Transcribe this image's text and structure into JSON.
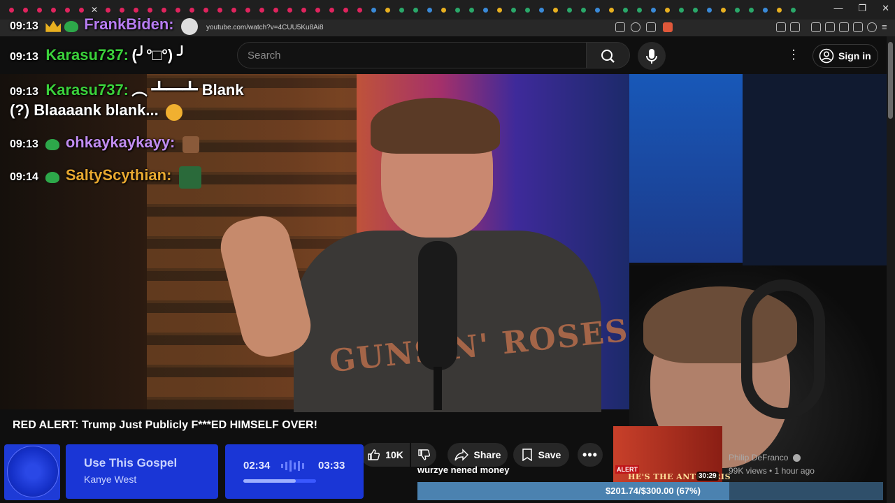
{
  "browser": {
    "url": "youtube.com/watch?v=4CUU5Ku8Ai8"
  },
  "header": {
    "search_placeholder": "Search",
    "sign_in_label": "Sign in"
  },
  "chat": [
    {
      "time": "09:13",
      "user": "FrankBiden:",
      "user_color": "#b77cf2",
      "message": ""
    },
    {
      "time": "09:13",
      "user": "Karasu737:",
      "user_color": "#3bd13b",
      "message": "(╯°□°) ╯"
    },
    {
      "time": "09:13",
      "user": "Karasu737:",
      "user_color": "#3bd13b",
      "message": "︵ ┻━┻ Blank"
    },
    {
      "time": "",
      "user": "",
      "user_color": "#ffffff",
      "message": "(?) Blaaaank blank..."
    },
    {
      "time": "09:13",
      "user": "ohkaykaykayy:",
      "user_color": "#c08cf0",
      "message": ""
    },
    {
      "time": "09:14",
      "user": "SaltyScythian:",
      "user_color": "#e8a830",
      "message": ""
    }
  ],
  "video": {
    "title": "RED ALERT: Trump Just Publicly F***ED HIMSELF OVER!",
    "shirt_text": "GUNS N' ROSES",
    "like_count": "10K",
    "share_label": "Share",
    "save_label": "Save",
    "comment_preview": "wurzye nened money"
  },
  "recommendation": {
    "thumb_alert": "ALERT",
    "thumb_banner": "HE'S THE ANTICHRIS",
    "duration": "30:29",
    "channel": "Philip DeFranco",
    "meta": "99K views • 1 hour ago"
  },
  "now_playing": {
    "song": "Use This Gospel",
    "artist": "Kanye West",
    "elapsed": "02:34",
    "total": "03:33",
    "progress": 0.72
  },
  "donation_goal": {
    "text": "$201.74/$300.00 (67%)",
    "progress": 0.67
  },
  "colors": {
    "accent_red": "#e0245e",
    "goal_fill": "#4b82b0",
    "now_playing_blue": "#1a36d6"
  }
}
